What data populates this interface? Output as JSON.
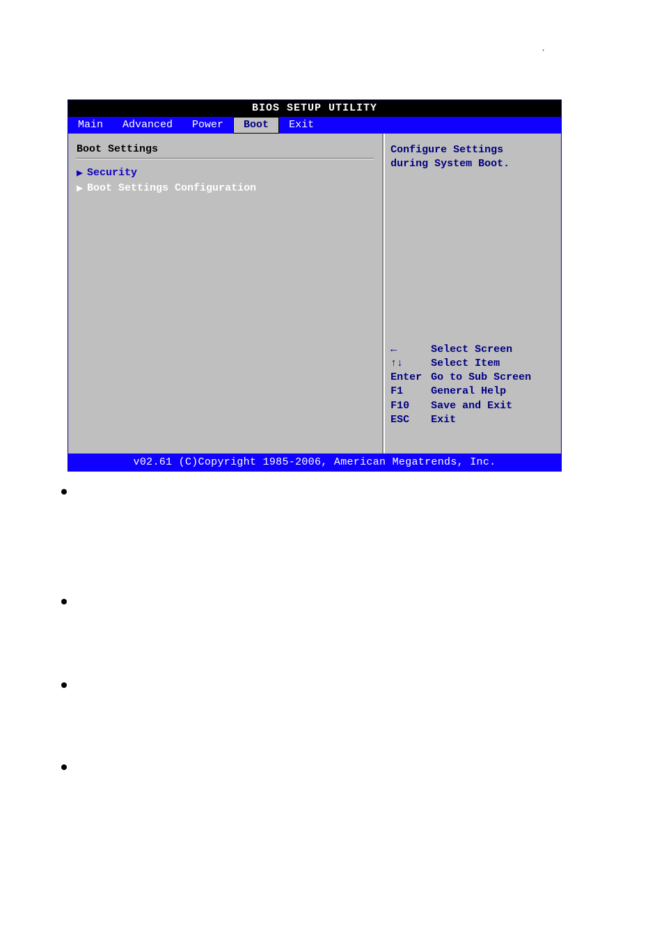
{
  "meta": {
    "page_number": ""
  },
  "bios": {
    "title": "BIOS SETUP UTILITY",
    "menu": {
      "items": [
        "Main",
        "Advanced",
        "Power",
        "Boot",
        "Exit"
      ],
      "active_index": 3
    },
    "left": {
      "section_title": "Boot Settings",
      "items": [
        {
          "label": "Security",
          "selected": true
        },
        {
          "label": "Boot Settings Configuration",
          "selected": false
        }
      ]
    },
    "right": {
      "description_lines": [
        "Configure Settings",
        "during System Boot."
      ],
      "keys": [
        {
          "key": "←",
          "action": "Select Screen"
        },
        {
          "key": "↑↓",
          "action": "Select Item"
        },
        {
          "key": "Enter",
          "action": "Go to Sub Screen"
        },
        {
          "key": "F1",
          "action": "General Help"
        },
        {
          "key": "F10",
          "action": "Save and Exit"
        },
        {
          "key": "ESC",
          "action": "Exit"
        }
      ]
    },
    "footer": "v02.61 (C)Copyright 1985-2006, American Megatrends, Inc."
  },
  "doc": {
    "bullets": [
      {
        "lead": ""
      },
      {
        "lead": ""
      },
      {
        "lead": ""
      },
      {
        "lead": ""
      }
    ]
  },
  "tick": ","
}
